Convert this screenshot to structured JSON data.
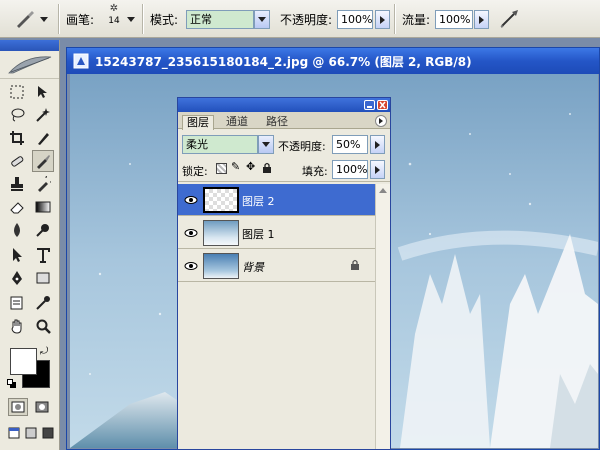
{
  "options_bar": {
    "brush_label": "画笔:",
    "brush_size": "14",
    "mode_label": "模式:",
    "mode_value": "正常",
    "opacity_label": "不透明度:",
    "opacity_value": "100%",
    "flow_label": "流量:",
    "flow_value": "100%",
    "icons": [
      "brush-preset-icon",
      "airbrush-icon"
    ]
  },
  "toolbox": {
    "tools": [
      "marquee-tool",
      "move-tool",
      "lasso-tool",
      "magic-wand-tool",
      "crop-tool",
      "slice-tool",
      "healing-brush-tool",
      "brush-tool",
      "clone-stamp-tool",
      "history-brush-tool",
      "eraser-tool",
      "gradient-tool",
      "blur-tool",
      "dodge-tool",
      "path-selection-tool",
      "type-tool",
      "pen-tool",
      "shape-tool",
      "notes-tool",
      "eyedropper-tool",
      "hand-tool",
      "zoom-tool"
    ],
    "active_tool": "brush-tool",
    "foreground_color": "#ffffff",
    "background_color": "#000000"
  },
  "document": {
    "title": "15243787_235615180184_2.jpg @ 66.7% (图层 2, RGB/8)"
  },
  "layers_panel": {
    "tabs": [
      "图层",
      "通道",
      "路径"
    ],
    "active_tab": "图层",
    "blend_mode": "柔光",
    "opacity_label": "不透明度:",
    "opacity_value": "50%",
    "lock_label": "锁定:",
    "fill_label": "填充:",
    "fill_value": "100%",
    "layers": [
      {
        "name": "图层 2",
        "selected": true,
        "visible": true
      },
      {
        "name": "图层 1",
        "selected": false,
        "visible": true
      },
      {
        "name": "背景",
        "selected": false,
        "visible": true,
        "locked": true
      }
    ]
  },
  "colors": {
    "title_bar": "#2456c7",
    "selected_layer": "#3e6bd0",
    "panel_bg": "#eceadf"
  }
}
